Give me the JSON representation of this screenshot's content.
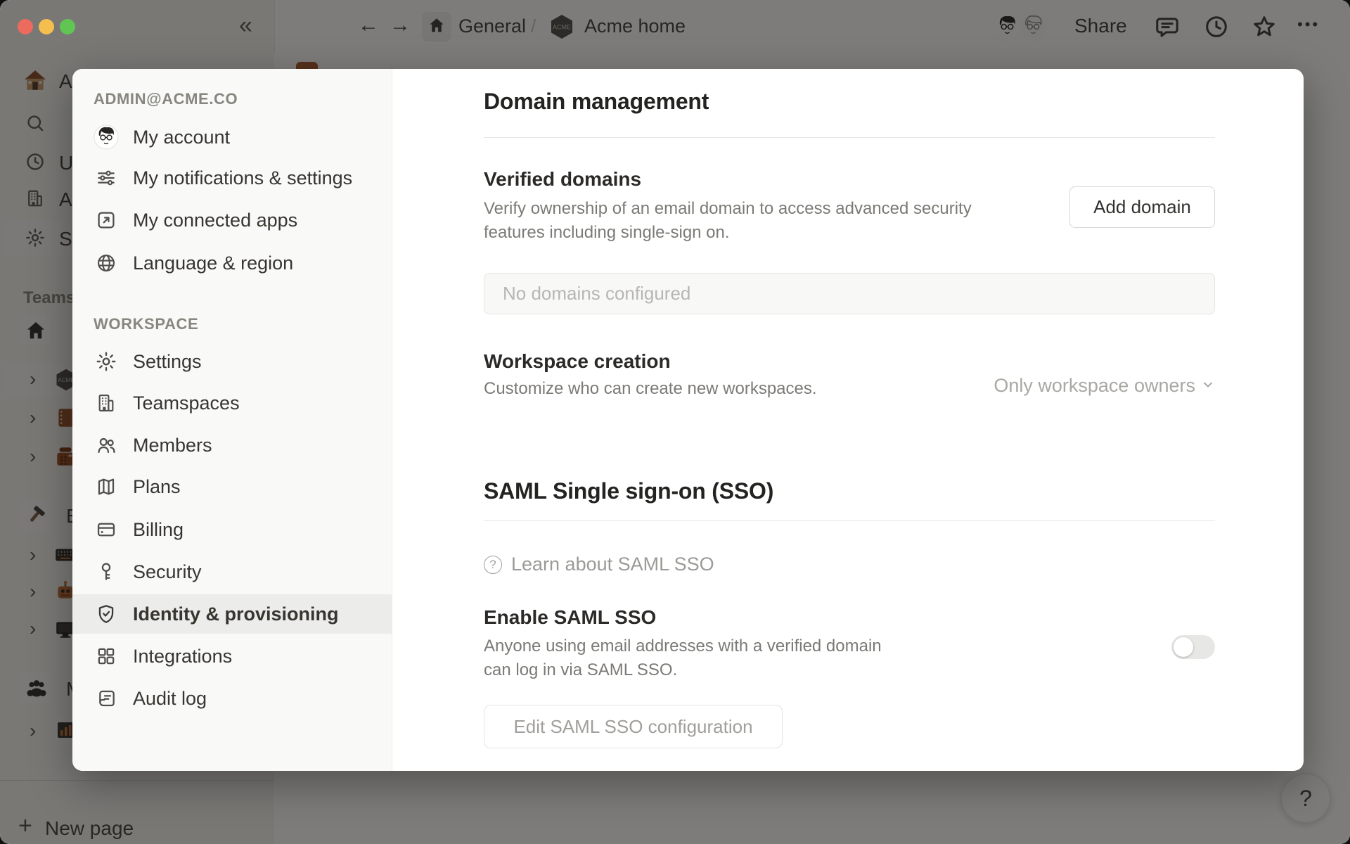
{
  "colors": {
    "overlay": "rgba(18,16,13,0.55)",
    "modal_bg": "#ffffff",
    "modal_sidebar_bg": "#f9f9f8",
    "selected_item_bg": "#ececeb",
    "text_primary": "#37352f",
    "text_secondary": "#7b7a76",
    "text_tertiary": "#9b9a97",
    "border": "#e6e6e4",
    "traffic_red": "#ec6a5e",
    "traffic_yellow": "#f4bf4f",
    "traffic_green": "#61c554",
    "accent_orange": "#a85a2e"
  },
  "topbar": {
    "collapse_icon": "«",
    "back_icon": "←",
    "forward_icon": "→",
    "breadcrumb": {
      "team": "General",
      "separator": "/",
      "page": "Acme home"
    },
    "logo_text": "ACME",
    "share_label": "Share",
    "more_icon": "•••"
  },
  "background_sidebar": {
    "workspace_letter": "A",
    "updates_letter": "U",
    "third_row_letter": "A",
    "settings_letter": "S",
    "teams_section_label": "Teams",
    "hammer_letter": "E",
    "members_letter": "M",
    "chevron_icon": "›",
    "new_page": {
      "plus_icon": "+",
      "label": "New page"
    }
  },
  "help_button": {
    "label": "?"
  },
  "modal": {
    "sidebar": {
      "account_section_label": "ADMIN@ACME.CO",
      "account_items": [
        {
          "label": "My account"
        },
        {
          "label": "My notifications & settings"
        },
        {
          "label": "My connected apps"
        },
        {
          "label": "Language & region"
        }
      ],
      "workspace_section_label": "WORKSPACE",
      "workspace_items": [
        {
          "label": "Settings",
          "selected": false
        },
        {
          "label": "Teamspaces",
          "selected": false
        },
        {
          "label": "Members",
          "selected": false
        },
        {
          "label": "Plans",
          "selected": false
        },
        {
          "label": "Billing",
          "selected": false
        },
        {
          "label": "Security",
          "selected": false
        },
        {
          "label": "Identity & provisioning",
          "selected": true
        },
        {
          "label": "Integrations",
          "selected": false
        },
        {
          "label": "Audit log",
          "selected": false
        }
      ]
    },
    "content": {
      "domain_management": {
        "title": "Domain management",
        "verified_domains": {
          "title": "Verified domains",
          "description_line1": "Verify ownership of an email domain to access advanced security",
          "description_line2": "features including single-sign on.",
          "add_button_label": "Add domain",
          "empty_placeholder": "No domains configured"
        },
        "workspace_creation": {
          "title": "Workspace creation",
          "description": "Customize who can create new workspaces.",
          "dropdown_value": "Only workspace owners"
        }
      },
      "saml": {
        "title": "SAML Single sign-on (SSO)",
        "learn_link_label": "Learn about SAML SSO",
        "help_glyph": "?",
        "enable": {
          "title": "Enable SAML SSO",
          "description_line1": "Anyone using email addresses with a verified domain",
          "description_line2": "can log in via SAML SSO.",
          "toggle_state": "off"
        },
        "edit_button_label": "Edit SAML SSO configuration"
      }
    }
  }
}
